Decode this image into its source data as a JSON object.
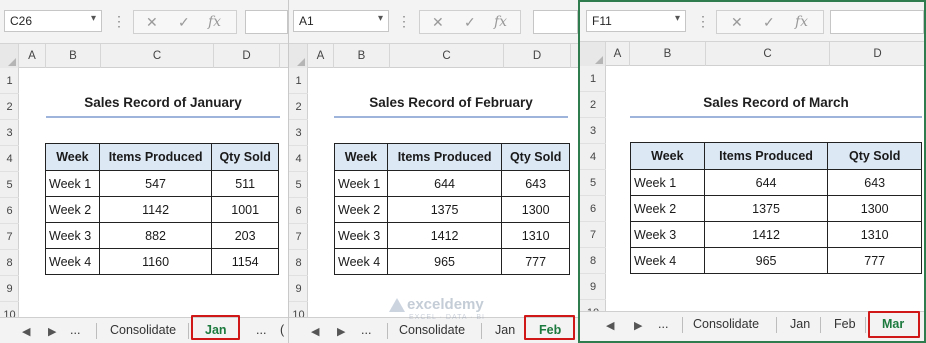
{
  "windows": [
    {
      "namebox": "C26",
      "columns": [
        "A",
        "B",
        "C",
        "D"
      ],
      "rows": [
        "1",
        "2",
        "3",
        "4",
        "5",
        "6",
        "7",
        "8",
        "9",
        "10"
      ],
      "title": "Sales Record of January",
      "headers": [
        "Week",
        "Items Produced",
        "Qty Sold"
      ],
      "records": [
        [
          "Week 1",
          "547",
          "511"
        ],
        [
          "Week 2",
          "1142",
          "1001"
        ],
        [
          "Week 3",
          "882",
          "203"
        ],
        [
          "Week 4",
          "1160",
          "1154"
        ]
      ],
      "tabs": [
        "Consolidate",
        "Jan",
        "...",
        "("
      ],
      "active_tab": "Jan"
    },
    {
      "namebox": "A1",
      "columns": [
        "A",
        "B",
        "C",
        "D"
      ],
      "rows": [
        "1",
        "2",
        "3",
        "4",
        "5",
        "6",
        "7",
        "8",
        "9",
        "10"
      ],
      "title": "Sales Record of February",
      "headers": [
        "Week",
        "Items Produced",
        "Qty Sold"
      ],
      "records": [
        [
          "Week 1",
          "644",
          "643"
        ],
        [
          "Week 2",
          "1375",
          "1300"
        ],
        [
          "Week 3",
          "1412",
          "1310"
        ],
        [
          "Week 4",
          "965",
          "777"
        ]
      ],
      "tabs": [
        "Consolidate",
        "Jan",
        "Feb"
      ],
      "active_tab": "Feb"
    },
    {
      "namebox": "F11",
      "columns": [
        "A",
        "B",
        "C",
        "D"
      ],
      "rows": [
        "1",
        "2",
        "3",
        "4",
        "5",
        "6",
        "7",
        "8",
        "9",
        "10"
      ],
      "title": "Sales Record of March",
      "headers": [
        "Week",
        "Items Produced",
        "Qty Sold"
      ],
      "records": [
        [
          "Week 1",
          "644",
          "643"
        ],
        [
          "Week 2",
          "1375",
          "1300"
        ],
        [
          "Week 3",
          "1412",
          "1310"
        ],
        [
          "Week 4",
          "965",
          "777"
        ]
      ],
      "tabs": [
        "Consolidate",
        "Jan",
        "Feb",
        "Mar"
      ],
      "active_tab": "Mar"
    }
  ],
  "ui": {
    "fx_label": "fx",
    "cancel_glyph": "✕",
    "enter_glyph": "✓",
    "nav_prev": "◀",
    "nav_next": "▶",
    "nav_more": "...",
    "dropdown_glyph": "▾"
  },
  "watermark": {
    "name": "exceldemy",
    "tagline": "EXCEL · DATA · BI"
  },
  "colors": {
    "table_header_fill": "#dde8f5",
    "active_tab_text": "#1d7a3e",
    "highlight_box": "#d01818",
    "title_underline": "#9fb4db"
  }
}
